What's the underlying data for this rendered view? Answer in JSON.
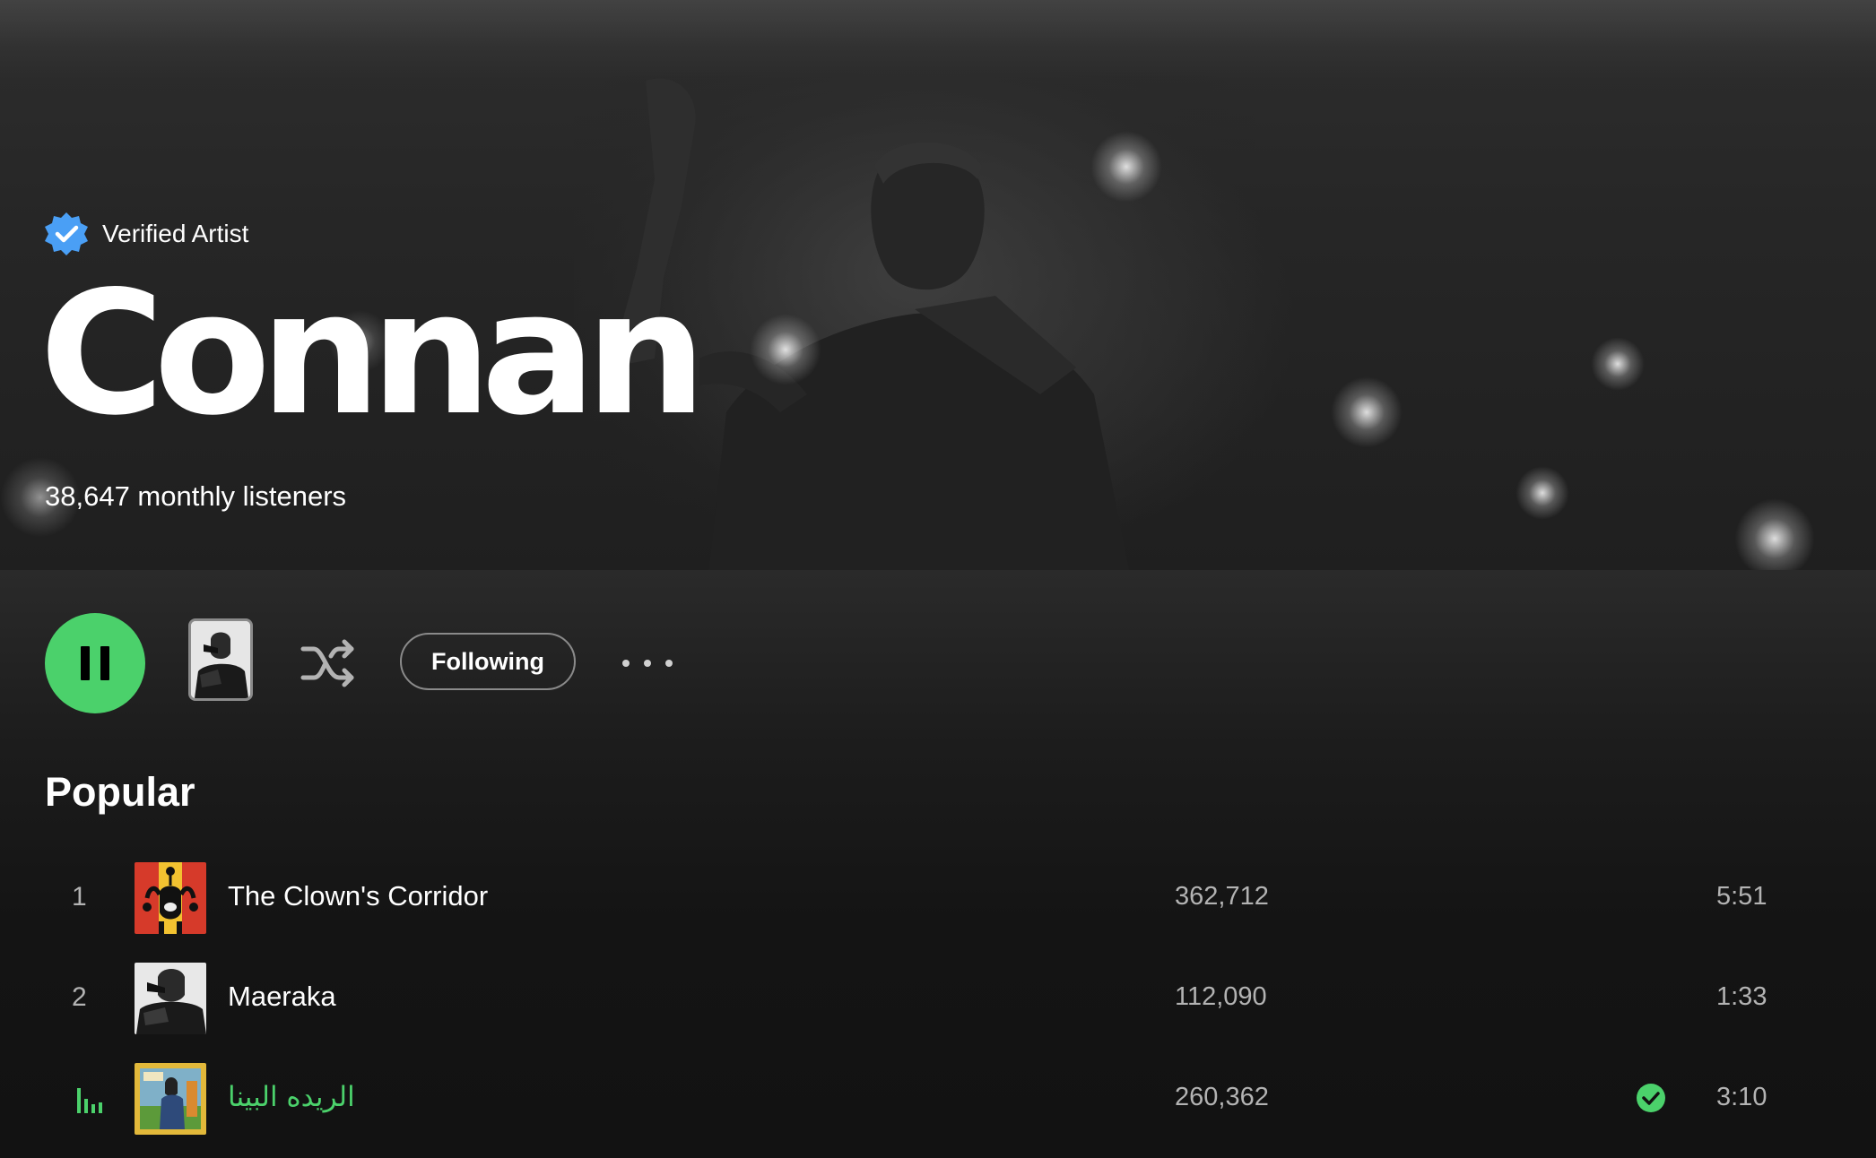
{
  "artist": {
    "verified_label": "Verified Artist",
    "name": "Connan",
    "monthly_listeners": "38,647 monthly listeners"
  },
  "actions": {
    "state": "playing",
    "follow_label": "Following"
  },
  "popular": {
    "title": "Popular",
    "tracks": [
      {
        "index": "1",
        "title": "The Clown's Corridor",
        "plays": "362,712",
        "duration": "5:51",
        "playing": false,
        "saved": false
      },
      {
        "index": "2",
        "title": "Maeraka",
        "plays": "112,090",
        "duration": "1:33",
        "playing": false,
        "saved": false
      },
      {
        "index": "",
        "title": "الريده البينا",
        "plays": "260,362",
        "duration": "3:10",
        "playing": true,
        "saved": true
      }
    ]
  },
  "colors": {
    "accent_green": "#4bd16b",
    "verified_blue": "#4a9ff5",
    "background": "#121212"
  },
  "icons": [
    "verified-badge-icon",
    "pause-icon",
    "shuffle-icon",
    "more-options-icon",
    "equalizer-icon",
    "saved-check-icon"
  ]
}
